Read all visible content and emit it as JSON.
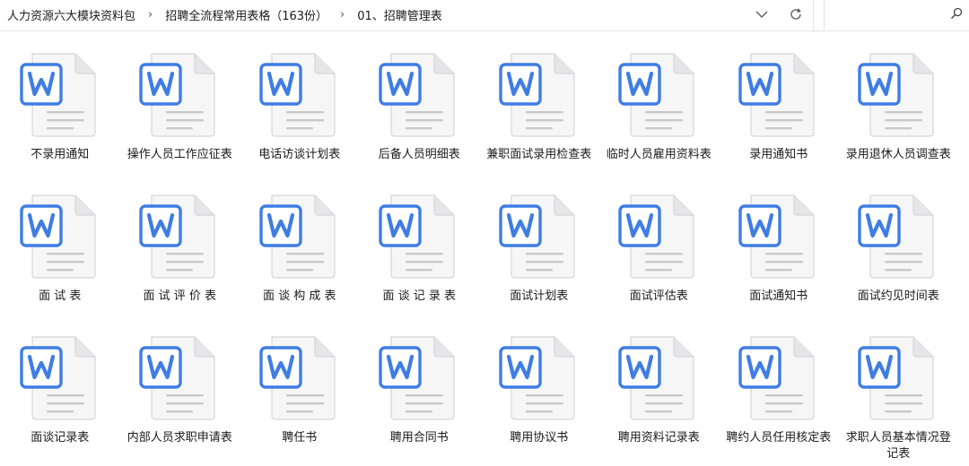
{
  "breadcrumb": {
    "items": [
      "人力资源六大模块资料包",
      "招聘全流程常用表格（163份）",
      "01、招聘管理表"
    ],
    "separator": "›"
  },
  "search": {
    "placeholder": ""
  },
  "colors": {
    "word_blue": "#3f7de4",
    "doc_fill": "#f7f7f8",
    "doc_line": "#c9c9c9"
  },
  "files": [
    {
      "name": "不录用通知",
      "icon": "word-doc-icon"
    },
    {
      "name": "操作人员工作应征表",
      "icon": "word-doc-icon"
    },
    {
      "name": "电话访谈计划表",
      "icon": "word-doc-icon"
    },
    {
      "name": "后备人员明细表",
      "icon": "word-doc-icon"
    },
    {
      "name": "兼职面试录用检查表",
      "icon": "word-doc-icon"
    },
    {
      "name": "临时人员雇用资料表",
      "icon": "word-doc-icon"
    },
    {
      "name": "录用通知书",
      "icon": "word-doc-icon"
    },
    {
      "name": "录用退休人员调查表",
      "icon": "word-doc-icon"
    },
    {
      "name": "面 试 表",
      "icon": "word-doc-icon"
    },
    {
      "name": "面 试 评 价 表",
      "icon": "word-doc-icon"
    },
    {
      "name": "面 谈 构 成 表",
      "icon": "word-doc-icon"
    },
    {
      "name": "面 谈 记 录 表",
      "icon": "word-doc-icon"
    },
    {
      "name": "面试计划表",
      "icon": "word-doc-icon"
    },
    {
      "name": "面试评估表",
      "icon": "word-doc-icon"
    },
    {
      "name": "面试通知书",
      "icon": "word-doc-icon"
    },
    {
      "name": "面试约见时间表",
      "icon": "word-doc-icon"
    },
    {
      "name": "面谈记录表",
      "icon": "word-doc-icon"
    },
    {
      "name": "内部人员求职申请表",
      "icon": "word-doc-icon"
    },
    {
      "name": "聘任书",
      "icon": "word-doc-icon"
    },
    {
      "name": "聘用合同书",
      "icon": "word-doc-icon"
    },
    {
      "name": "聘用协议书",
      "icon": "word-doc-icon"
    },
    {
      "name": "聘用资料记录表",
      "icon": "word-doc-icon"
    },
    {
      "name": "聘约人员任用核定表",
      "icon": "word-doc-icon"
    },
    {
      "name": "求职人员基本情况登记表",
      "icon": "word-doc-icon"
    }
  ]
}
